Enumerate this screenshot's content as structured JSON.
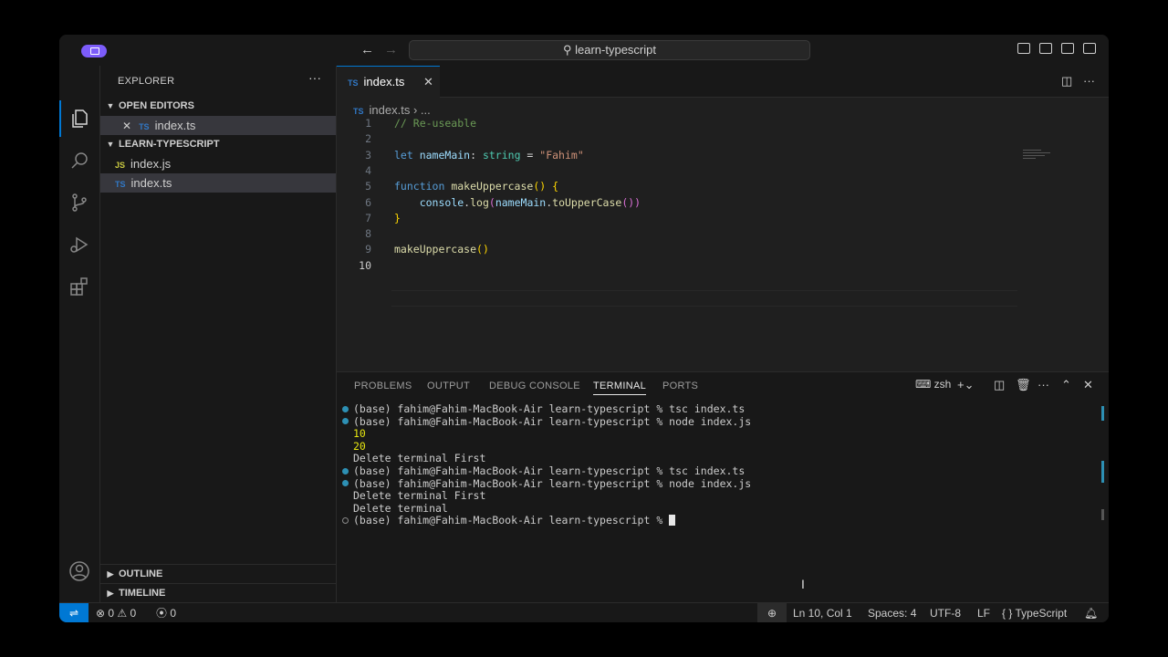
{
  "titlebar": {
    "search_text": "learn-typescript",
    "back_icon": "arrow-left-icon",
    "forward_icon": "arrow-right-icon"
  },
  "sidebar": {
    "title": "EXPLORER",
    "more": "···",
    "open_editors_label": "OPEN EDITORS",
    "open_editors": [
      {
        "icon": "TS",
        "name": "index.ts"
      }
    ],
    "project_label": "LEARN-TYPESCRIPT",
    "files": [
      {
        "icon": "JS",
        "name": "index.js"
      },
      {
        "icon": "TS",
        "name": "index.ts"
      }
    ],
    "outline_label": "OUTLINE",
    "timeline_label": "TIMELINE"
  },
  "editor": {
    "tab": {
      "icon": "TS",
      "name": "index.ts",
      "close": "✕"
    },
    "breadcrumb": {
      "icon": "TS",
      "file": "index.ts",
      "rest": "›  ..."
    },
    "lines": [
      {
        "num": "1",
        "tokens": [
          [
            "c-com",
            "// Re-useable"
          ]
        ]
      },
      {
        "num": "2",
        "tokens": []
      },
      {
        "num": "3",
        "tokens": [
          [
            "c-kw",
            "let "
          ],
          [
            "c-var",
            "nameMain"
          ],
          [
            "c-pun",
            ": "
          ],
          [
            "c-type",
            "string"
          ],
          [
            "c-pun",
            " = "
          ],
          [
            "c-str",
            "\"Fahim\""
          ]
        ]
      },
      {
        "num": "4",
        "tokens": []
      },
      {
        "num": "5",
        "tokens": [
          [
            "c-kw",
            "function "
          ],
          [
            "c-fn",
            "makeUppercase"
          ],
          [
            "c-br1",
            "() {"
          ]
        ]
      },
      {
        "num": "6",
        "tokens": [
          [
            "c-pun",
            "    "
          ],
          [
            "c-var",
            "console"
          ],
          [
            "c-pun",
            "."
          ],
          [
            "c-fn",
            "log"
          ],
          [
            "c-br2",
            "("
          ],
          [
            "c-var",
            "nameMain"
          ],
          [
            "c-pun",
            "."
          ],
          [
            "c-fn",
            "toUpperCase"
          ],
          [
            "c-br2",
            "())"
          ]
        ]
      },
      {
        "num": "7",
        "tokens": [
          [
            "c-br1",
            "}"
          ]
        ]
      },
      {
        "num": "8",
        "tokens": []
      },
      {
        "num": "9",
        "tokens": [
          [
            "c-fn",
            "makeUppercase"
          ],
          [
            "c-br1",
            "()"
          ]
        ]
      },
      {
        "num": "10",
        "tokens": []
      }
    ]
  },
  "panel": {
    "tabs": [
      "PROBLEMS",
      "OUTPUT",
      "DEBUG CONSOLE",
      "TERMINAL",
      "PORTS"
    ],
    "active_tab": "TERMINAL",
    "shell": "zsh",
    "terminal": [
      {
        "dot": "blue",
        "text": "(base) fahim@Fahim-MacBook-Air learn-typescript % tsc index.ts"
      },
      {
        "dot": "blue",
        "text": "(base) fahim@Fahim-MacBook-Air learn-typescript % node index.js"
      },
      {
        "dot": "none",
        "text": "10",
        "yellow": true
      },
      {
        "dot": "none",
        "text": "20",
        "yellow": true
      },
      {
        "dot": "none",
        "text": "Delete terminal First"
      },
      {
        "dot": "blue",
        "text": "(base) fahim@Fahim-MacBook-Air learn-typescript % tsc index.ts"
      },
      {
        "dot": "blue",
        "text": "(base) fahim@Fahim-MacBook-Air learn-typescript % node index.js"
      },
      {
        "dot": "none",
        "text": "Delete terminal First"
      },
      {
        "dot": "none",
        "text": "Delete terminal"
      },
      {
        "dot": "hollow",
        "text": "(base) fahim@Fahim-MacBook-Air learn-typescript % ",
        "cursor": true
      }
    ]
  },
  "statusbar": {
    "remote": "⇌",
    "errors": "0",
    "warnings": "0",
    "ports": "0",
    "position": "Ln 10, Col 1",
    "spaces": "Spaces: 4",
    "encoding": "UTF-8",
    "eol": "LF",
    "language": "TypeScript",
    "language_prefix": "{ }"
  },
  "colors": {
    "accent": "#0078d4",
    "badge": "#7c5cfa",
    "ts": "#3178c6",
    "js": "#cbcb41"
  }
}
